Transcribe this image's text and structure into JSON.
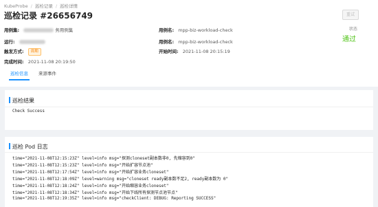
{
  "breadcrumb": [
    "KubeProbe",
    "巡检记录",
    "巡检详情"
  ],
  "title": "巡检记录 #26656749",
  "retry_button_label": "重试",
  "fields": {
    "usecase_label": "用例集:",
    "usecase_value_visible": "务用例集",
    "run_label": "运行:",
    "trigger_label": "触发方式:",
    "trigger_value": "周期",
    "finish_label": "完成时间:",
    "finish_value": "2021-11-08 20:19:50",
    "casename1_label": "用例名:",
    "casename1_value": "mpp-biz-workload-check",
    "casename2_label": "用例名:",
    "casename2_value": "mpp-biz-workload-check",
    "start_label": "开始时间:",
    "start_value": "2021-11-08 20:15:19"
  },
  "status": {
    "label": "状态",
    "value": "通过",
    "color": "#52c41a"
  },
  "tabs": [
    {
      "label": "巡检信息",
      "active": true
    },
    {
      "label": "来源事件",
      "active": false
    }
  ],
  "result_card": {
    "title": "巡检结果",
    "text": "Check Success"
  },
  "log_card": {
    "title": "巡检 Pod 日志",
    "lines": [
      "time=\"2021-11-08T12:15:23Z\" level=info msg=\"探测cloneset副本数非0, 先缩容到0\"",
      "time=\"2021-11-08T12:15:23Z\" level=info msg=\"开始扩容节点池\"",
      "time=\"2021-11-08T12:17:54Z\" level=info msg=\"开始扩容业务cloneset\"",
      "time=\"2021-11-08T12:18:09Z\" level=warning msg=\"cloneset ready副本数不足2, ready副本数为 0\"",
      "time=\"2021-11-08T12:18:24Z\" level=info msg=\"开始缩容业务cloneset\"",
      "time=\"2021-11-08T12:18:34Z\" level=info msg=\"开始下线所有探测节点池节点\"",
      "time=\"2021-11-08T12:19:35Z\" level=info msg=\"checkClient: DEBUG: Reporting SUCCESS\""
    ]
  },
  "colors": {
    "accent": "#1890ff",
    "background": "#f0f2f5"
  }
}
